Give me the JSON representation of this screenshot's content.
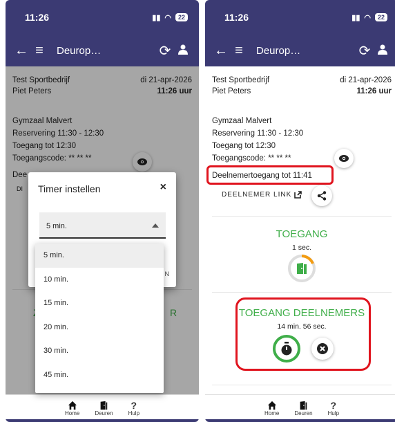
{
  "status": {
    "time": "11:26",
    "battery": "22"
  },
  "appbar": {
    "title": "Deurop…"
  },
  "details": {
    "company": "Test Sportbedrijf",
    "date": "di 21-apr-2026",
    "person": "Piet Peters",
    "time": "11:26 uur",
    "location": "Gymzaal Malvert",
    "reservation": "Reservering 11:30 - 12:30",
    "access_until": "Toegang tot 12:30",
    "access_code": "Toegangscode: ** ** **",
    "participant_access": "Deelnemertoegang tot 11:41",
    "participant_link": "DEELNEMER LINK"
  },
  "left_bg": {
    "participant_partial": "Dee",
    "link_partial": "DI",
    "dialog_right_edge": "N",
    "toegang_left": "Z",
    "toegang_right": "R"
  },
  "dialog": {
    "title": "Timer instellen",
    "close": "×",
    "selected": "5 min."
  },
  "dropdown": {
    "options": [
      "5 min.",
      "10 min.",
      "15 min.",
      "20 min.",
      "30 min.",
      "45 min."
    ]
  },
  "toegang": {
    "title": "TOEGANG",
    "timer": "1 sec."
  },
  "deelnemers": {
    "title": "TOEGANG DEELNEMERS",
    "timer": "14 min. 56 sec."
  },
  "bottomnav": {
    "home": "Home",
    "doors": "Deuren",
    "help": "Hulp"
  },
  "colors": {
    "header": "#3b3a73",
    "accent_green": "#3fae49",
    "highlight_red": "#e0141e",
    "progress_orange": "#f39c12"
  }
}
